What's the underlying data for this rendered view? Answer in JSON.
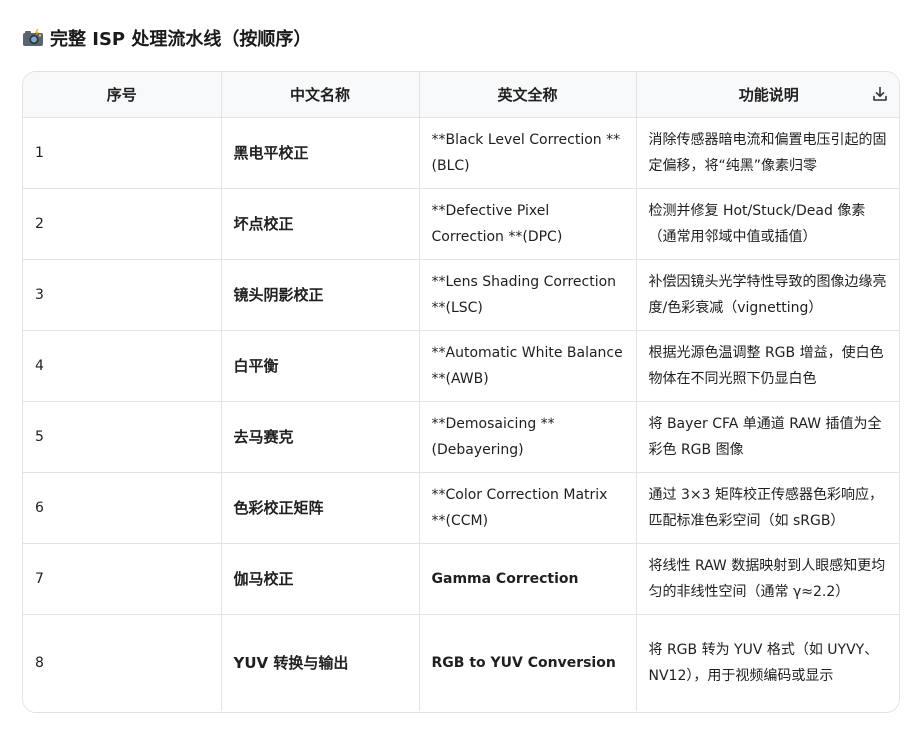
{
  "heading": {
    "icon": "camera-flash-icon",
    "text": "完整 ISP 处理流水线（按顺序）"
  },
  "table": {
    "headers": [
      "序号",
      "中文名称",
      "英文全称",
      "功能说明"
    ],
    "download_icon": "download-icon",
    "rows": [
      {
        "num": "1",
        "cn": "黑电平校正",
        "en": "**Black Level Correction **(BLC)",
        "desc": "消除传感器暗电流和偏置电压引起的固定偏移，将“纯黑”像素归零"
      },
      {
        "num": "2",
        "cn": "坏点校正",
        "en": "**Defective Pixel Correction **(DPC)",
        "desc": "检测并修复 Hot/Stuck/Dead 像素（通常用邻域中值或插值）"
      },
      {
        "num": "3",
        "cn": "镜头阴影校正",
        "en": "**Lens Shading Correction **(LSC)",
        "desc": "补偿因镜头光学特性导致的图像边缘亮度/色彩衰减（vignetting）"
      },
      {
        "num": "4",
        "cn": "白平衡",
        "en": "**Automatic White Balance **(AWB)",
        "desc": "根据光源色温调整 RGB 增益，使白色物体在不同光照下仍显白色"
      },
      {
        "num": "5",
        "cn": "去马赛克",
        "en": "**Demosaicing **(Debayering)",
        "desc": "将 Bayer CFA 单通道 RAW 插值为全彩色 RGB 图像"
      },
      {
        "num": "6",
        "cn": "色彩校正矩阵",
        "en": "**Color Correction Matrix **(CCM)",
        "desc": "通过 3×3 矩阵校正传感器色彩响应，匹配标准色彩空间（如 sRGB）"
      },
      {
        "num": "7",
        "cn": "伽马校正",
        "en": "Gamma Correction",
        "desc": "将线性 RAW 数据映射到人眼感知更均匀的非线性空间（通常 γ≈2.2）"
      },
      {
        "num": "8",
        "cn": "YUV 转换与输出",
        "en": "RGB to YUV Conversion",
        "desc": "将 RGB 转为 YUV 格式（如 UYVY、NV12），用于视频编码或显示"
      }
    ]
  }
}
